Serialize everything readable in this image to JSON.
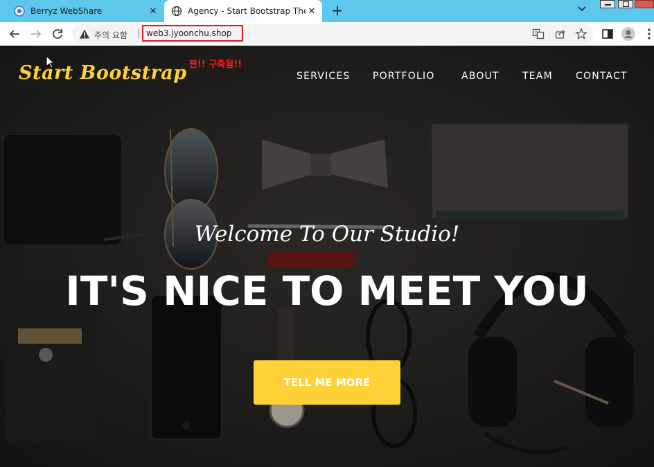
{
  "tabs": [
    {
      "title": "Berryz WebShare",
      "active": false,
      "icon": "berryz-favicon"
    },
    {
      "title": "Agency - Start Bootstrap Theme",
      "active": true,
      "icon": "globe-icon"
    }
  ],
  "addressBar": {
    "securityLabel": "주의 요함",
    "url": "web3.jyoonchu.shop"
  },
  "annotation": "짠!! 구축됨!!",
  "site": {
    "brand": "Start Bootstrap",
    "nav": [
      "SERVICES",
      "PORTFOLIO",
      "ABOUT",
      "TEAM",
      "CONTACT"
    ],
    "subheading": "Welcome To Our Studio!",
    "heading": "IT'S NICE TO MEET YOU",
    "cta": "TELL ME MORE"
  },
  "colors": {
    "tabStrip": "#5ec8ec",
    "accent": "#fed136",
    "annotationRed": "#e31b1b"
  }
}
